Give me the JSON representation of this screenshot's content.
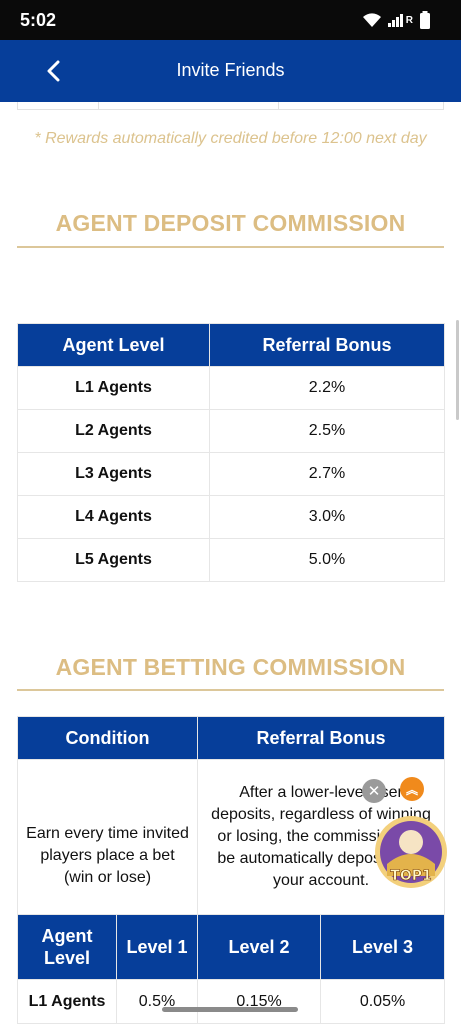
{
  "status_bar": {
    "time": "5:02",
    "network_label": "R"
  },
  "app_bar": {
    "title": "Invite Friends"
  },
  "note": "* Rewards automatically credited before 12:00 next day",
  "deposit_section": {
    "title": "AGENT DEPOSIT COMMISSION",
    "headers": [
      "Agent Level",
      "Referral Bonus"
    ],
    "rows": [
      {
        "level": "L1 Agents",
        "bonus": "2.2%"
      },
      {
        "level": "L2 Agents",
        "bonus": "2.5%"
      },
      {
        "level": "L3 Agents",
        "bonus": "2.7%"
      },
      {
        "level": "L4 Agents",
        "bonus": "3.0%"
      },
      {
        "level": "L5 Agents",
        "bonus": "5.0%"
      }
    ]
  },
  "betting_section": {
    "title": "AGENT BETTING COMMISSION",
    "headers": [
      "Condition",
      "Referral Bonus"
    ],
    "condition": "Earn every time invited players place a bet (win or lose)",
    "bonus_desc": "After a lower-level user deposits, regardless of winning or losing, the commission will be automatically deposited to your account.",
    "sub_headers": [
      "Agent Level",
      "Level 1",
      "Level 2",
      "Level 3"
    ],
    "rows": [
      {
        "level": "L1 Agents",
        "l1": "0.5%",
        "l2": "0.15%",
        "l3": "0.05%"
      }
    ]
  },
  "floating": {
    "close": "✕",
    "top": "︽",
    "badge_text": "TOP1"
  },
  "colors": {
    "primary": "#063e9a",
    "gold": "#dcbd83",
    "orange": "#f08a1c"
  }
}
